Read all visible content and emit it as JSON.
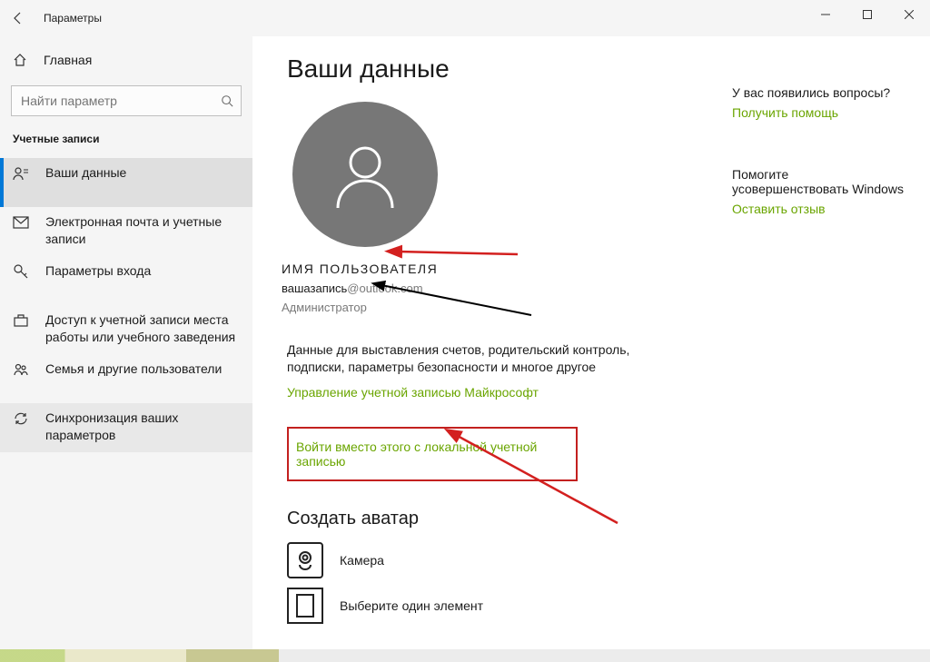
{
  "window": {
    "title": "Параметры"
  },
  "sidebar": {
    "home": "Главная",
    "search_placeholder": "Найти параметр",
    "section": "Учетные записи",
    "items": [
      {
        "label": "Ваши данные"
      },
      {
        "label": "Электронная почта и учетные записи"
      },
      {
        "label": "Параметры входа"
      },
      {
        "label": "Доступ к учетной записи места работы или учебного заведения"
      },
      {
        "label": "Семья и другие пользователи"
      },
      {
        "label": "Синхронизация ваших параметров"
      }
    ]
  },
  "main": {
    "heading": "Ваши данные",
    "username": "ИМЯ ПОЛЬЗОВАТЕЛЯ",
    "email_local": "вашазапись",
    "email_domain": "@outlook.com",
    "role": "Администратор",
    "billing_text": "Данные для выставления счетов, родительский контроль, подписки, параметры безопасности и многое другое",
    "manage_link": "Управление учетной записью Майкрософт",
    "local_signin": "Войти вместо этого с локальной учетной записью",
    "create_avatar": "Создать аватар",
    "camera": "Камера",
    "browse": "Выберите один элемент"
  },
  "help": {
    "question": "У вас появились вопросы?",
    "help_link": "Получить помощь",
    "improve": "Помогите усовершенствовать Windows",
    "feedback_link": "Оставить отзыв"
  },
  "colors": {
    "link_green": "#6aa500",
    "accent_blue": "#0078d7",
    "frame_red": "#c3201f"
  }
}
